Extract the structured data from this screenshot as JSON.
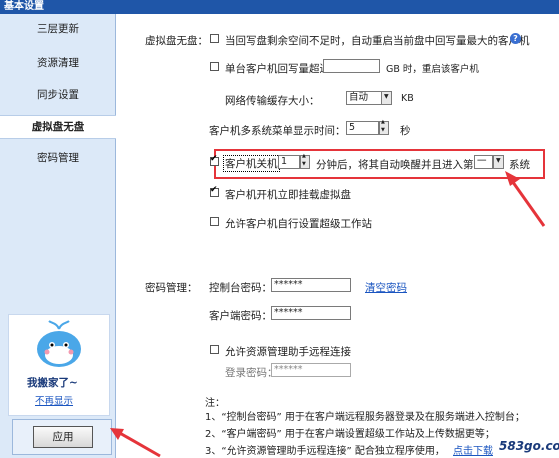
{
  "window": {
    "title": "基本设置"
  },
  "sidebar": {
    "items": [
      {
        "label": "三层更新"
      },
      {
        "label": "资源清理"
      },
      {
        "label": "同步设置"
      },
      {
        "label": "虚拟盘无盘"
      },
      {
        "label": "密码管理"
      }
    ],
    "active_index": 3,
    "promo": {
      "text": "我搬家了~",
      "link": "不再显示"
    },
    "apply_label": "应用"
  },
  "vdisk": {
    "section_label": "虚拟盘无盘：",
    "opt1": "当回写盘剩余空间不足时，自动重启当前盘中回写量最大的客户机",
    "opt2_prefix": "单台客户机回写量超过",
    "opt2_unit": "GB 时，重启该客户机",
    "net_cache_label": "网络传输缓存大小：",
    "net_cache_value": "自动",
    "net_cache_unit": "KB",
    "menu_time_label": "客户机多系统菜单显示时间：",
    "menu_time_value": "5",
    "menu_time_unit": "秒",
    "shutdown_label": "客户机关机",
    "shutdown_value": "1",
    "shutdown_mid": "分钟后，将其自动唤醒并且进入第",
    "shutdown_sys_value": "一",
    "shutdown_suffix": "系统",
    "mount_label": "客户机开机立即挂载虚拟盘",
    "superws_label": "允许客户机自行设置超级工作站"
  },
  "password": {
    "section_label": "密码管理：",
    "console_label": "控制台密码：",
    "console_value": "******",
    "clear_link": "清空密码",
    "client_label": "客户端密码：",
    "client_value": "******",
    "remote_label": "允许资源管理助手远程连接",
    "login_label": "登录密码：",
    "login_value": "******"
  },
  "notes": {
    "title": "注：",
    "line1": "1、“控制台密码” 用于在客户端远程服务器登录及在服务端进入控制台；",
    "line2": "2、“客户端密码” 用于在客户端设置超级工作站及上传数据更等；",
    "line3_prefix": "3、“允许资源管理助手远程连接” 配合独立程序使用，",
    "line3_link": "点击下载"
  },
  "watermark": "583go.com",
  "colors": {
    "accent": "#1f56a8",
    "highlight": "#e5343a",
    "sidebar_bg": "#dce9f8"
  }
}
